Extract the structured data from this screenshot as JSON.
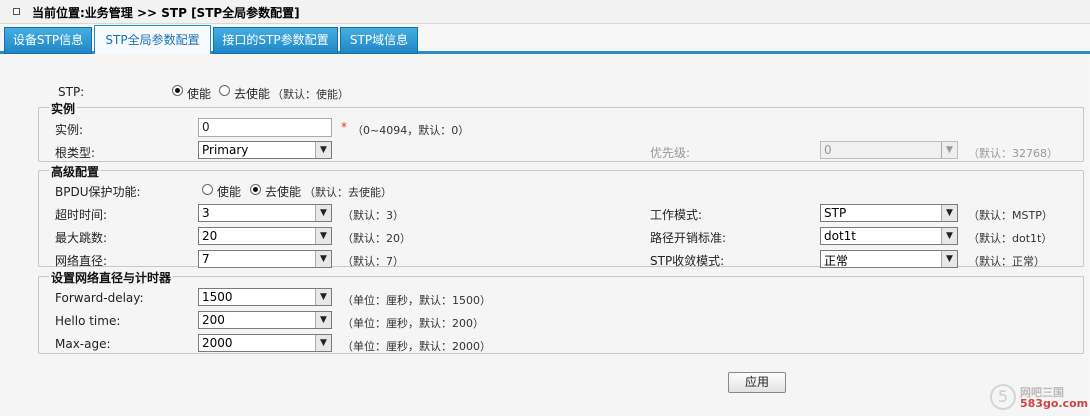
{
  "breadcrumb": {
    "text": "当前位置:业务管理 >> STP [STP全局参数配置]"
  },
  "tabs": [
    {
      "label": "设备STP信息"
    },
    {
      "label": "STP全局参数配置"
    },
    {
      "label": "接口的STP参数配置"
    },
    {
      "label": "STP域信息"
    }
  ],
  "stp": {
    "label": "STP:",
    "option_enable": "使能",
    "option_disable": "去使能",
    "hint": "（默认：使能）",
    "selected": "使能"
  },
  "instance_section": {
    "legend": "实例",
    "instance_label": "实例:",
    "instance_value": "0",
    "required_mark": "*",
    "instance_hint": "（0~4094，默认：0）",
    "root_type_label": "根类型:",
    "root_type_value": "Primary",
    "priority_label": "优先级:",
    "priority_value": "0",
    "priority_hint": "（默认：32768）"
  },
  "advanced_section": {
    "legend": "高级配置",
    "bpdu_label": "BPDU保护功能:",
    "bpdu_enable": "使能",
    "bpdu_disable": "去使能",
    "bpdu_hint": "（默认：去使能）",
    "bpdu_selected": "去使能",
    "timeout_label": "超时时间:",
    "timeout_value": "3",
    "timeout_hint": "（默认：3）",
    "max_hops_label": "最大跳数:",
    "max_hops_value": "20",
    "max_hops_hint": "（默认：20）",
    "diameter_label": "网络直径:",
    "diameter_value": "7",
    "diameter_hint": "（默认：7）",
    "work_mode_label": "工作模式:",
    "work_mode_value": "STP",
    "work_mode_hint": "（默认：MSTP）",
    "path_cost_label": "路径开销标准:",
    "path_cost_value": "dot1t",
    "path_cost_hint": "（默认：dot1t）",
    "convergence_label": "STP收敛模式:",
    "convergence_value": "正常",
    "convergence_hint": "（默认：正常）"
  },
  "timer_section": {
    "legend": "设置网络直径与计时器",
    "forward_delay_label": "Forward-delay:",
    "forward_delay_value": "1500",
    "forward_delay_hint": "（单位：厘秒，默认：1500）",
    "hello_label": "Hello time:",
    "hello_value": "200",
    "hello_hint": "（单位：厘秒，默认：200）",
    "max_age_label": "Max-age:",
    "max_age_value": "2000",
    "max_age_hint": "（单位：厘秒，默认：2000）"
  },
  "apply_button": "应用",
  "watermark": {
    "logo_icon": "5",
    "line1": "网吧三国",
    "line2": "583go.com"
  },
  "colors": {
    "tab_active_text": "#1a6fb3",
    "tab_bg": "#2a8fc7",
    "required": "#ee3333"
  }
}
